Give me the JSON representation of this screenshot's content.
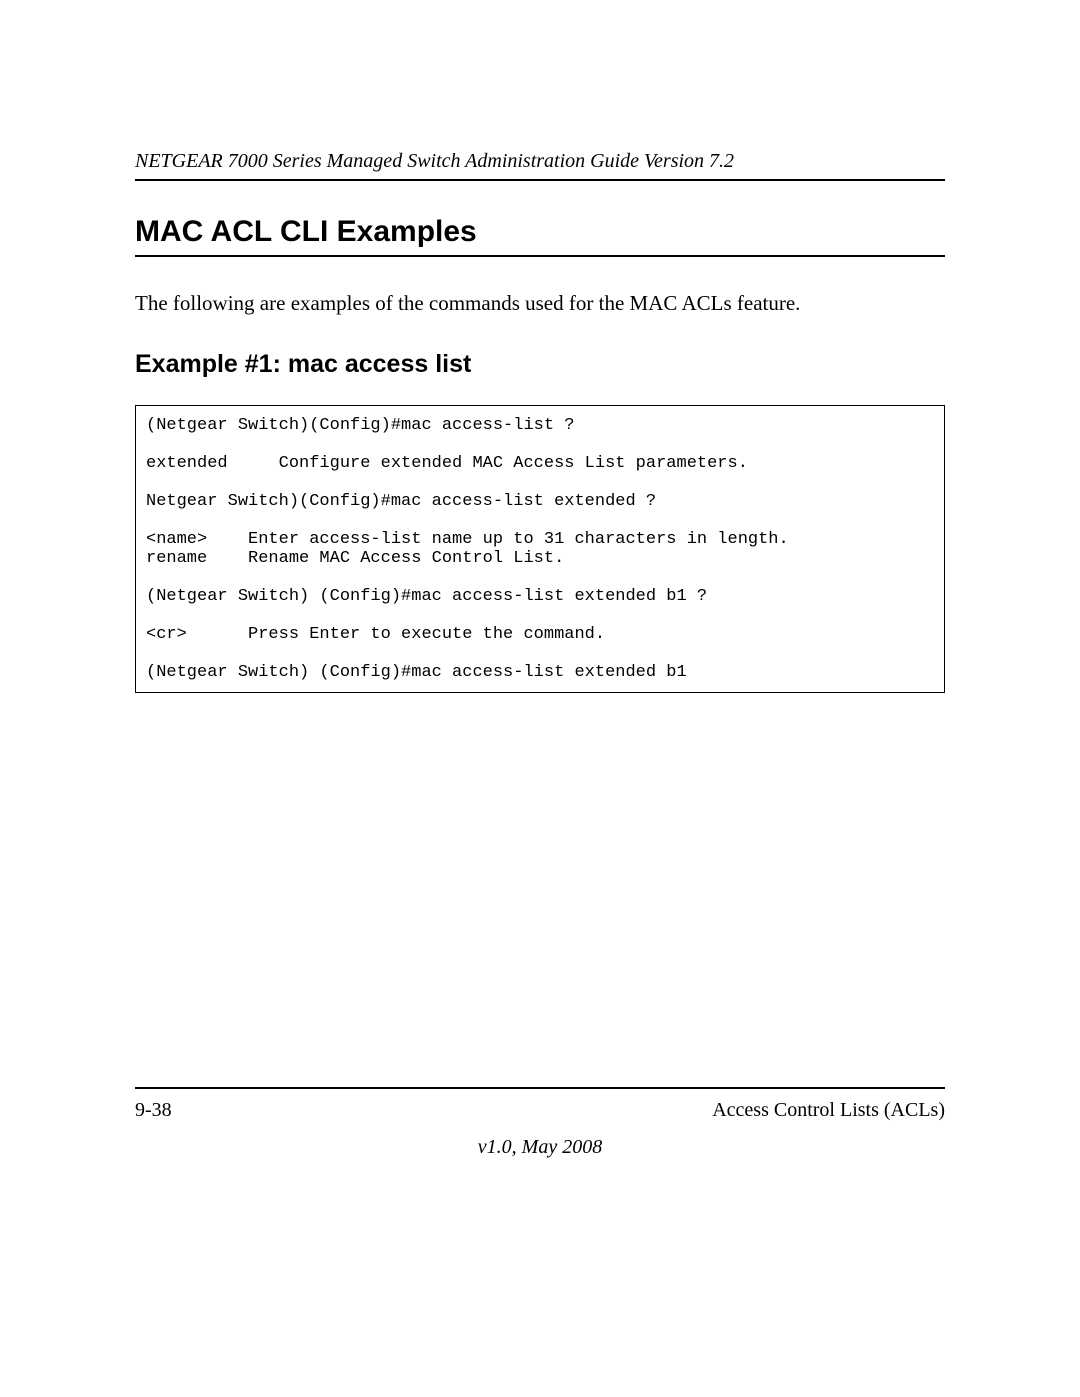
{
  "header": {
    "running_head": "NETGEAR 7000 Series Managed Switch Administration Guide Version 7.2"
  },
  "section": {
    "title": "MAC ACL CLI Examples",
    "intro": "The following are examples of the commands used for the MAC ACLs feature.",
    "example_title": "Example #1: mac access list"
  },
  "code": {
    "block": "(Netgear Switch)(Config)#mac access-list ?\n\nextended     Configure extended MAC Access List parameters.\n\nNetgear Switch)(Config)#mac access-list extended ?\n\n<name>    Enter access-list name up to 31 characters in length.\nrename    Rename MAC Access Control List.\n\n(Netgear Switch) (Config)#mac access-list extended b1 ?\n\n<cr>      Press Enter to execute the command.\n\n(Netgear Switch) (Config)#mac access-list extended b1"
  },
  "footer": {
    "page_num": "9-38",
    "section_name": "Access Control Lists (ACLs)",
    "version": "v1.0, May 2008"
  }
}
